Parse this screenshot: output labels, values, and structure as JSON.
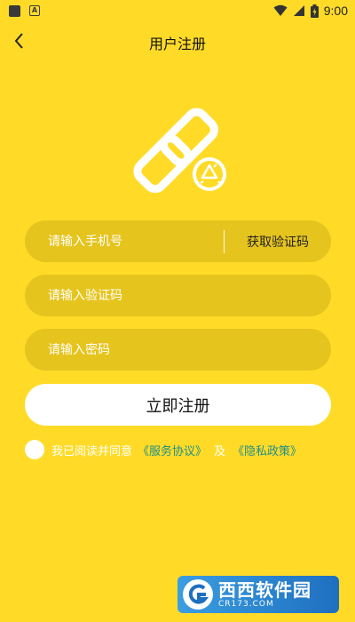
{
  "status_bar": {
    "time": "9:00"
  },
  "header": {
    "title": "用户注册"
  },
  "form": {
    "phone_placeholder": "请输入手机号",
    "get_code_label": "获取验证码",
    "code_placeholder": "请输入验证码",
    "password_placeholder": "请输入密码",
    "register_label": "立即注册"
  },
  "agreement": {
    "prefix": "我已阅读并同意",
    "service_link": "《服务协议》",
    "and": "及",
    "privacy_link": "《隐私政策》"
  },
  "watermark": {
    "title": "西西软件园",
    "subtitle": "CR173.COM"
  },
  "colors": {
    "background": "#FFDB27",
    "field": "#E6C41E",
    "link": "#1f8f8a",
    "button": "#FFFFFF"
  }
}
